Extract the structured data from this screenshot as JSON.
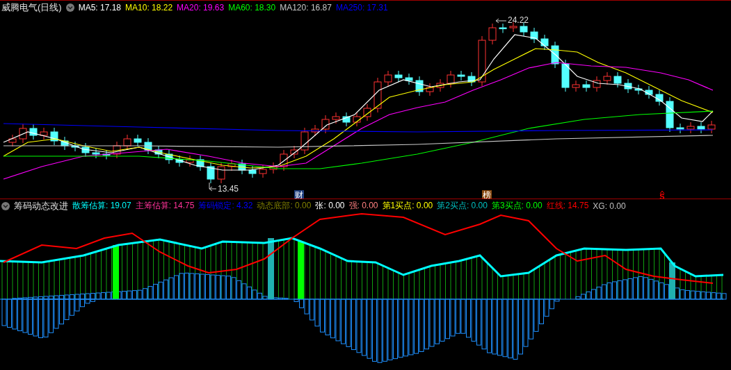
{
  "main_chart": {
    "title": "威腾电气(日线)",
    "indicators": [
      {
        "label": "MA5:",
        "value": "17.18",
        "color": "#ffffff"
      },
      {
        "label": "MA10:",
        "value": "18.22",
        "color": "#ffff00"
      },
      {
        "label": "MA20:",
        "value": "19.63",
        "color": "#ff00ff"
      },
      {
        "label": "MA60:",
        "value": "18.30",
        "color": "#00ff00"
      },
      {
        "label": "MA120:",
        "value": "16.87",
        "color": "#c8c8c8"
      },
      {
        "label": "MA250:",
        "value": "17.31",
        "color": "#0000ff"
      }
    ],
    "high_label": "24.22",
    "low_label": "13.45",
    "markers": [
      {
        "kind": "tag",
        "text": "财",
        "color": "#1f3f7f"
      },
      {
        "kind": "tag",
        "text": "榜",
        "color": "#8a4a10"
      },
      {
        "kind": "signal",
        "text": "S",
        "color": "#ff0000"
      }
    ]
  },
  "sub_chart": {
    "title": "筹码动态改进",
    "indicators": [
      {
        "label": "散筹估算:",
        "value": "19.07",
        "color": "#00ffff"
      },
      {
        "label": "主筹估算:",
        "value": "14.75",
        "color": "#ff3399"
      },
      {
        "label": "筹码锁定:",
        "value": "4.32",
        "color": "#0000ff"
      },
      {
        "label": "动态底部:",
        "value": "0.00",
        "color": "#808000"
      },
      {
        "label": "张:",
        "value": "0.00",
        "color": "#ffffff"
      },
      {
        "label": "强:",
        "value": "0.00",
        "color": "#ff8080"
      },
      {
        "label": "第1买点:",
        "value": "0.00",
        "color": "#ffff00"
      },
      {
        "label": "第2买点:",
        "value": "0.00",
        "color": "#00c0c0"
      },
      {
        "label": "第3买点:",
        "value": "0.00",
        "color": "#00ff00"
      },
      {
        "label": "红线:",
        "value": "14.75",
        "color": "#ff0000"
      },
      {
        "label": "XG:",
        "value": "0.00",
        "color": "#c0c0c0"
      }
    ]
  }
}
